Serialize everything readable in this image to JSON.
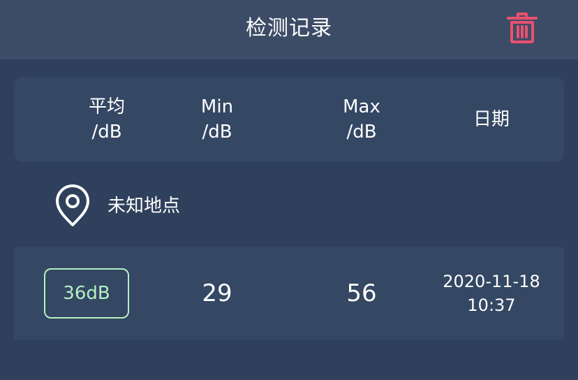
{
  "header": {
    "title": "检测记录",
    "delete_icon": "trash-icon",
    "delete_color": "#e9516e"
  },
  "columns": {
    "avg": {
      "label": "平均",
      "unit": "/dB"
    },
    "min": {
      "label": "Min",
      "unit": "/dB"
    },
    "max": {
      "label": "Max",
      "unit": "/dB"
    },
    "date": {
      "label": "日期"
    }
  },
  "location": {
    "icon": "location-pin-icon",
    "name": "未知地点"
  },
  "records": [
    {
      "avg": "36dB",
      "min": "29",
      "max": "56",
      "date": "2020-11-18",
      "time": "10:37"
    }
  ],
  "colors": {
    "background": "#2e405b",
    "header": "#3d4c66",
    "card": "#344763",
    "accent_green": "#b3f1c2"
  }
}
